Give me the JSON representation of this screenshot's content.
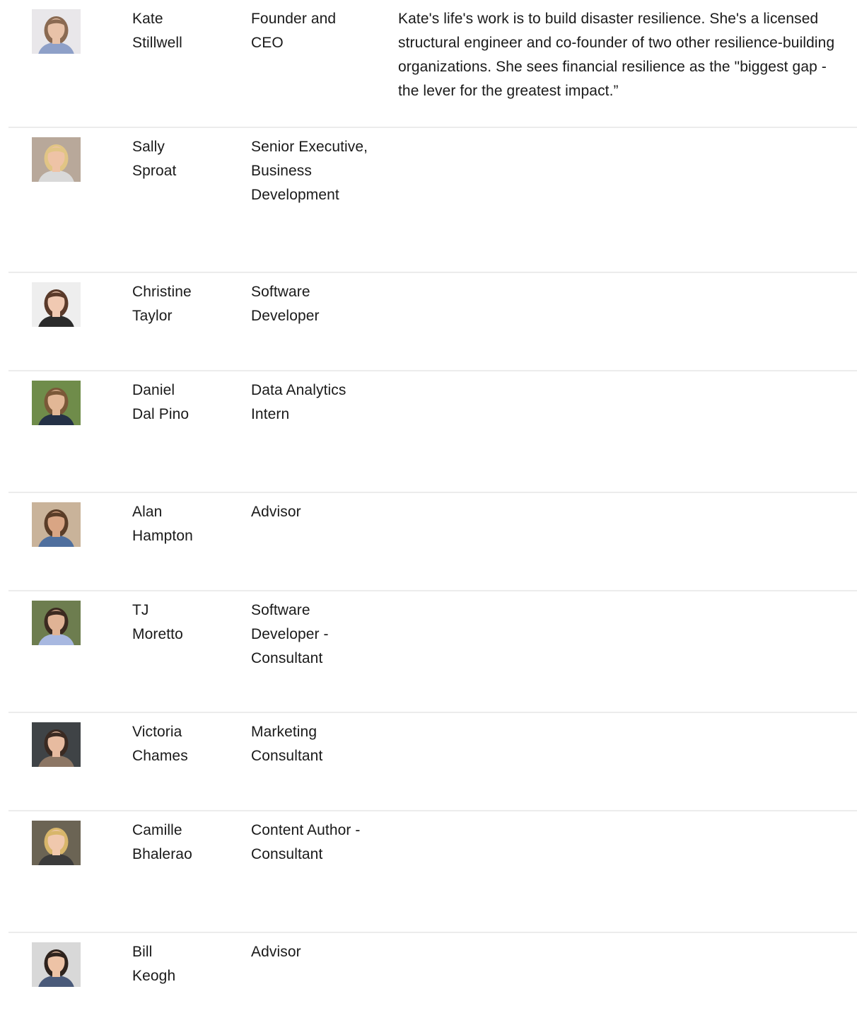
{
  "team": [
    {
      "name_first": "Kate",
      "name_last": "Stillwell",
      "title": "Founder and CEO",
      "bio": "Kate's life's work is to build disaster resilience. She's a licensed structural engineer and co-founder of two other resilience-building organizations. She sees financial resilience as the \"biggest gap - the lever for the greatest impact.”",
      "photo": {
        "bg": "#e9e7ea",
        "skin": "#e8c2a8",
        "hair": "#8a6a52",
        "shirt": "#8ea0c8"
      }
    },
    {
      "name_first": "Sally",
      "name_last": "Sproat",
      "title": "Senior Executive, Business Development",
      "bio": "",
      "photo": {
        "bg": "#b8a89a",
        "skin": "#eec3a6",
        "hair": "#e1c585",
        "shirt": "#d9d9d9"
      }
    },
    {
      "name_first": "Christine",
      "name_last": "Taylor",
      "title": "Software Developer",
      "bio": "",
      "photo": {
        "bg": "#eeeeee",
        "skin": "#f0c9b2",
        "hair": "#5a3a2a",
        "shirt": "#2b2b2b"
      }
    },
    {
      "name_first": "Daniel",
      "name_last": "Dal Pino",
      "title": "Data Analytics Intern",
      "bio": "",
      "photo": {
        "bg": "#6f8c4a",
        "skin": "#e2b796",
        "hair": "#7a5838",
        "shirt": "#243146"
      }
    },
    {
      "name_first": "Alan",
      "name_last": "Hampton",
      "title": "Advisor",
      "bio": "",
      "photo": {
        "bg": "#c9b39a",
        "skin": "#d9a584",
        "hair": "#5a3d28",
        "shirt": "#4f6f9e"
      }
    },
    {
      "name_first": "TJ",
      "name_last": "Moretto",
      "title": "Software Developer - Consultant",
      "bio": "",
      "photo": {
        "bg": "#6d7d4f",
        "skin": "#e0b395",
        "hair": "#3b2a20",
        "shirt": "#a8b8e0"
      }
    },
    {
      "name_first": "Victoria",
      "name_last": "Chames",
      "title": "Marketing Consultant",
      "bio": "",
      "photo": {
        "bg": "#3f4346",
        "skin": "#e7bba0",
        "hair": "#3a2a22",
        "shirt": "#8c7664"
      }
    },
    {
      "name_first": "Camille",
      "name_last": "Bhalerao",
      "title": "Content Author - Consultant",
      "bio": "",
      "photo": {
        "bg": "#6b6454",
        "skin": "#f0c8ad",
        "hair": "#d8b66a",
        "shirt": "#3b3b3b"
      }
    },
    {
      "name_first": "Bill",
      "name_last": "Keogh",
      "title": "Advisor",
      "bio": "",
      "photo": {
        "bg": "#d8d8d8",
        "skin": "#edc3a6",
        "hair": "#2e231d",
        "shirt": "#4a5a7a"
      }
    }
  ]
}
